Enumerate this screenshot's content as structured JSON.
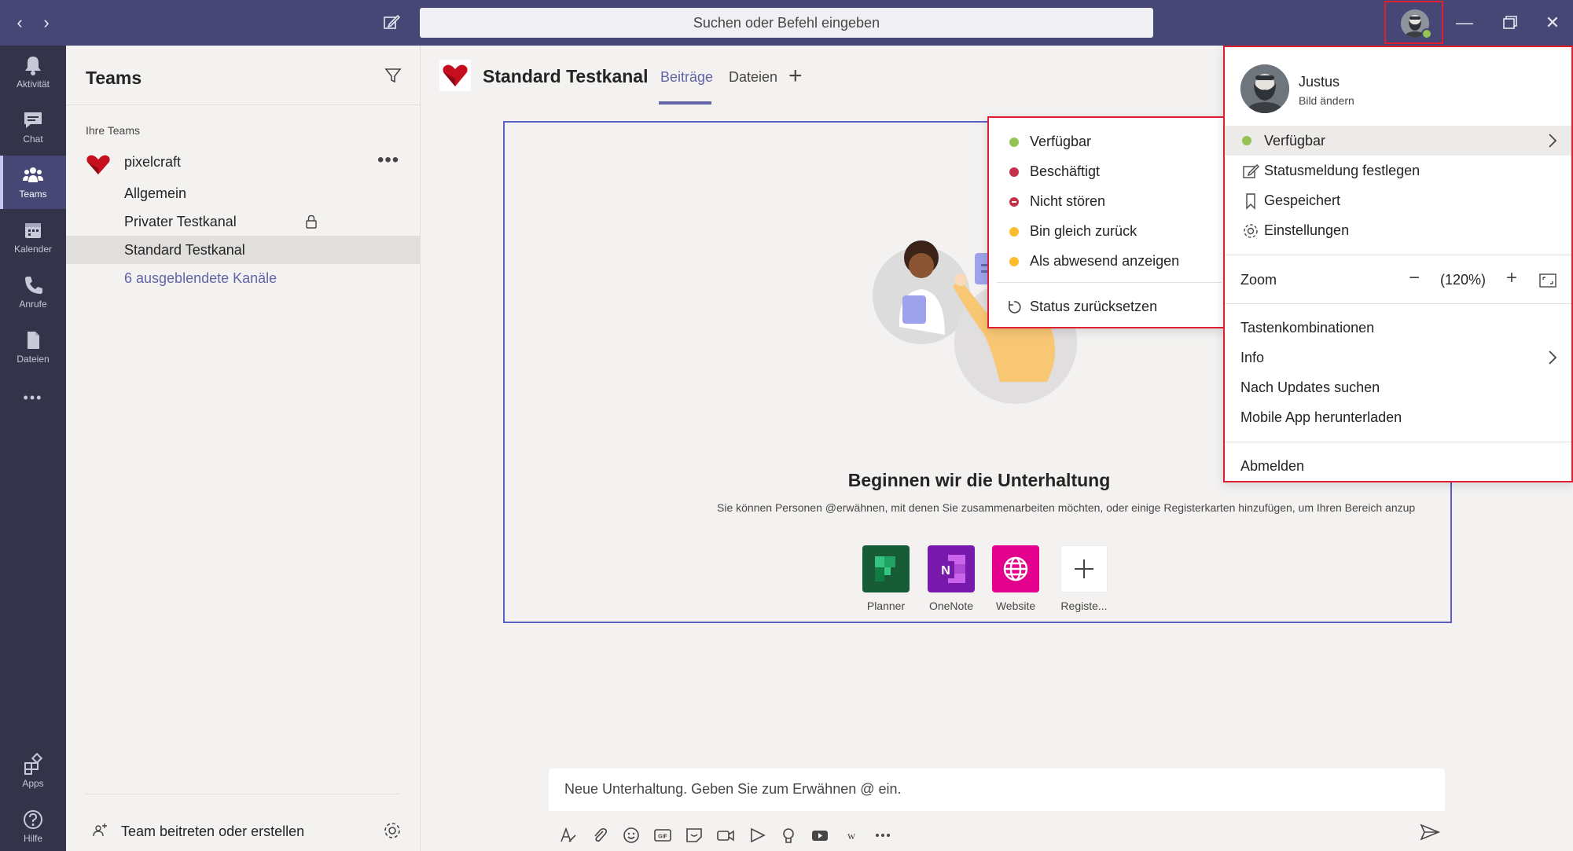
{
  "titlebar": {
    "back_glyph": "‹",
    "forward_glyph": "›",
    "search_placeholder": "Suchen oder Befehl eingeben",
    "min_glyph": "—",
    "close_glyph": "✕"
  },
  "rail": {
    "items": [
      {
        "label": "Aktivität",
        "icon": "bell-icon"
      },
      {
        "label": "Chat",
        "icon": "chat-icon"
      },
      {
        "label": "Teams",
        "icon": "teams-icon"
      },
      {
        "label": "Kalender",
        "icon": "calendar-icon"
      },
      {
        "label": "Anrufe",
        "icon": "phone-icon"
      },
      {
        "label": "Dateien",
        "icon": "file-icon"
      }
    ],
    "more_glyph": "•••",
    "apps_label": "Apps",
    "help_label": "Hilfe"
  },
  "teams_panel": {
    "title": "Teams",
    "section_label": "Ihre Teams",
    "team_name": "pixelcraft",
    "more_glyph": "•••",
    "channels": [
      "Allgemein",
      "Privater Testkanal",
      "Standard Testkanal"
    ],
    "hidden_channels": "6 ausgeblendete Kanäle",
    "join_label": "Team beitreten oder erstellen"
  },
  "channel": {
    "title": "Standard Testkanal",
    "tabs": [
      "Beiträge",
      "Dateien"
    ],
    "add_tab_glyph": "+"
  },
  "welcome": {
    "title": "Beginnen wir die Unterhaltung",
    "subtitle": "Sie können Personen @erwähnen, mit denen Sie zusammenarbeiten möchten, oder einige Registerkarten hinzufügen, um Ihren Bereich anzup",
    "apps": [
      {
        "label": "Planner",
        "color": "#185c37"
      },
      {
        "label": "OneNote",
        "color": "#7719aa"
      },
      {
        "label": "Website",
        "color": "#e3008c"
      },
      {
        "label": "Registe...",
        "color": "#ffffff"
      }
    ]
  },
  "composer": {
    "placeholder": "Neue Unterhaltung. Geben Sie zum Erwähnen @ ein."
  },
  "status_menu": {
    "items": [
      {
        "label": "Verfügbar",
        "color": "#92c353"
      },
      {
        "label": "Beschäftigt",
        "color": "#c4314b"
      },
      {
        "label": "Nicht stören",
        "color": "#c4314b"
      },
      {
        "label": "Bin gleich zurück",
        "color": "#fcbd2d"
      },
      {
        "label": "Als abwesend anzeigen",
        "color": "#fcbd2d"
      }
    ],
    "reset_label": "Status zurücksetzen"
  },
  "profile_menu": {
    "name": "Justus",
    "change_picture": "Bild ändern",
    "status": "Verfügbar",
    "status_color": "#92c353",
    "set_status_message": "Statusmeldung festlegen",
    "saved": "Gespeichert",
    "settings": "Einstellungen",
    "zoom_label": "Zoom",
    "zoom_minus": "−",
    "zoom_value": "(120%)",
    "zoom_plus": "+",
    "shortcuts": "Tastenkombinationen",
    "info": "Info",
    "check_updates": "Nach Updates suchen",
    "download_mobile": "Mobile App herunterladen",
    "sign_out": "Abmelden"
  }
}
